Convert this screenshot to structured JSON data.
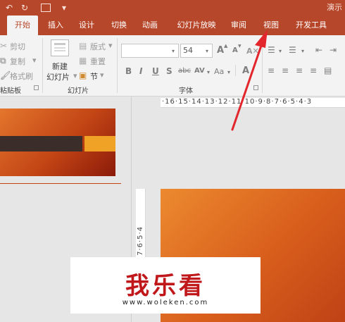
{
  "window": {
    "title": "演示"
  },
  "qat": {
    "undo": "↶",
    "redo": "↻",
    "customize": "▾"
  },
  "tabs": [
    {
      "label": "开始",
      "active": true
    },
    {
      "label": "插入"
    },
    {
      "label": "设计"
    },
    {
      "label": "切换"
    },
    {
      "label": "动画"
    },
    {
      "label": "幻灯片放映"
    },
    {
      "label": "审阅"
    },
    {
      "label": "视图"
    },
    {
      "label": "开发工具"
    }
  ],
  "clipboard": {
    "cut": "剪切",
    "copy": "复制",
    "format_painter": "格式刷",
    "group_label": "粘贴板"
  },
  "slides_group": {
    "new_slide_line1": "新建",
    "new_slide_line2": "幻灯片",
    "layout": "版式",
    "reset": "重置",
    "section": "节",
    "group_label": "幻灯片"
  },
  "font_group": {
    "font_name": "",
    "font_size": "54",
    "grow": "A",
    "shrink": "A",
    "bold": "B",
    "italic": "I",
    "underline": "U",
    "shadow": "S",
    "strikethrough": "abc",
    "spacing": "AV",
    "change_case": "Aa",
    "font_color": "A",
    "group_label": "字体"
  },
  "ruler": {
    "horizontal": "·16·15·14·13·12·11·10·9·8·7·6·5·4·3",
    "vertical": "9·8·7·6·5·4"
  },
  "watermark": {
    "text": "我乐看",
    "url": "www.woleken.com"
  },
  "colors": {
    "accent": "#b7472a",
    "slide_orange": "#e4762c",
    "arrow": "#e3262c"
  }
}
